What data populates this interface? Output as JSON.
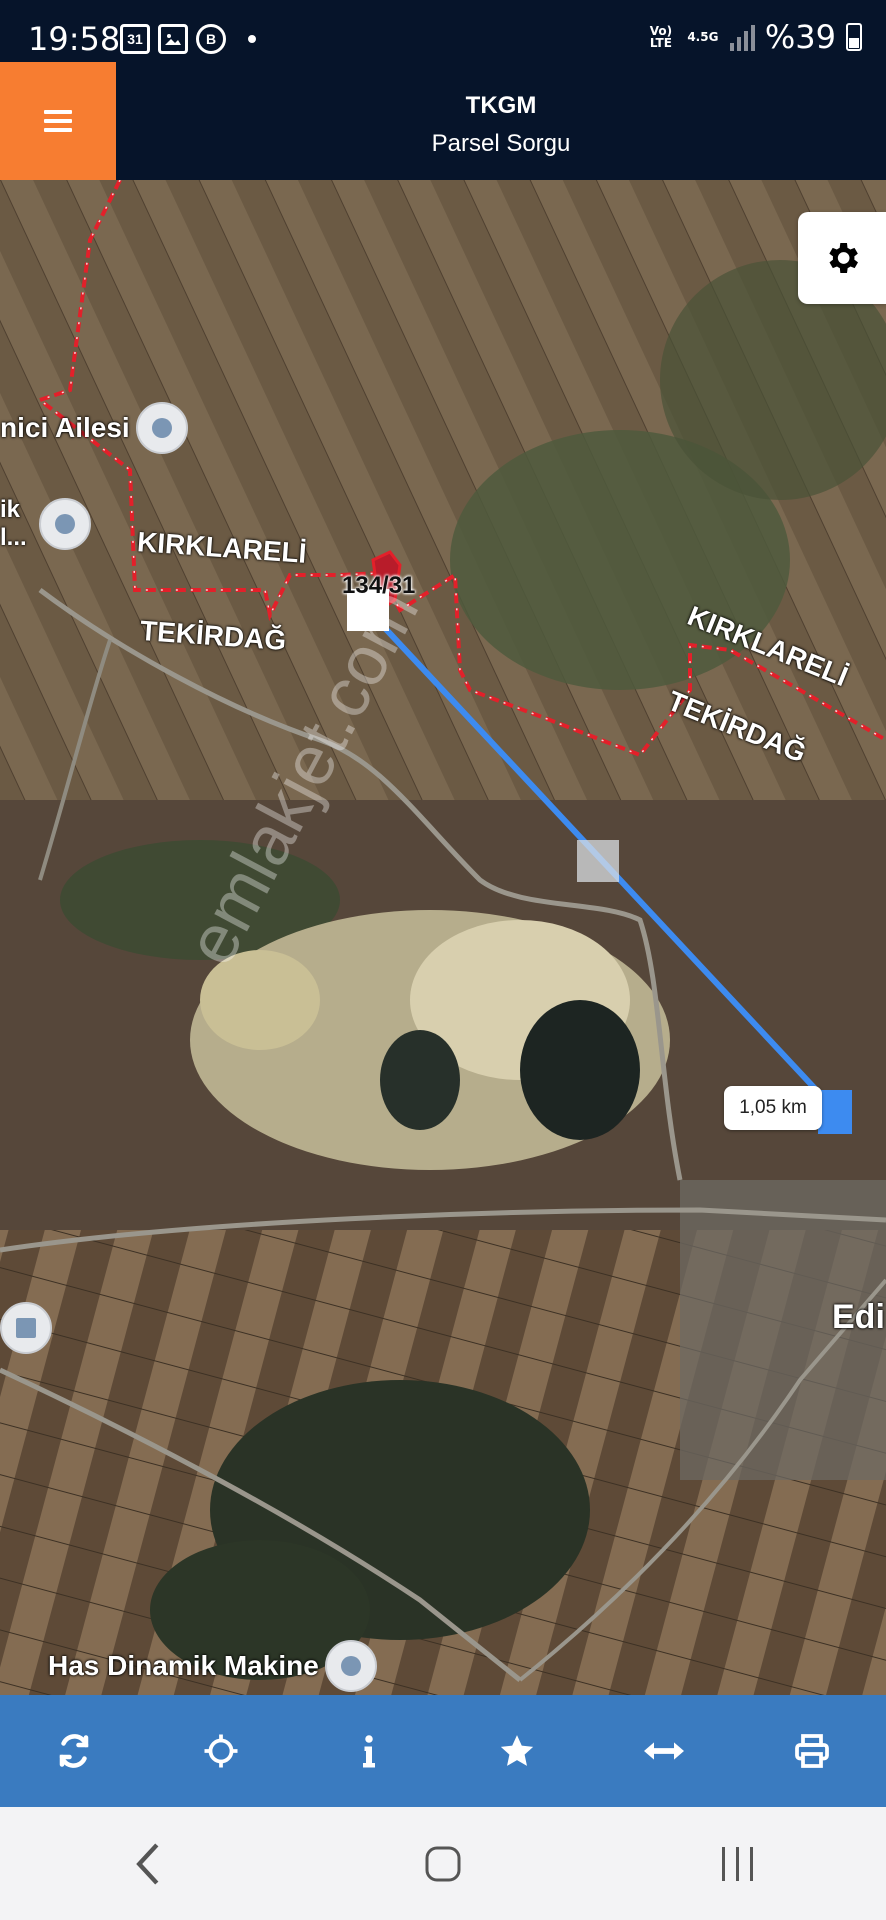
{
  "status_bar": {
    "time": "19:58",
    "left_icons": [
      "calendar-icon",
      "gallery-icon",
      "b-app-icon",
      "notification-dot-icon"
    ],
    "calendar_day": "31",
    "b_app_letter": "B",
    "network_top": "Vo) LTE",
    "network_type": "4.5G",
    "battery": "%39"
  },
  "header": {
    "menu_icon": "hamburger-menu-icon",
    "title": "TKGM",
    "subtitle": "Parsel Sorgu",
    "accent_color": "#f77d31",
    "background_color": "#06142a"
  },
  "map": {
    "settings_icon": "gear-icon",
    "labels": {
      "region_north_1": "KIRKLARELİ",
      "region_south_1": "TEKİRDAĞ",
      "region_north_2": "KIRKLARELİ",
      "region_south_2": "TEKİRDAĞ",
      "town": "Edi"
    },
    "pois": {
      "poi_1": "nici Ailesi",
      "poi_2_line1": "ik",
      "poi_2_line2": "l...",
      "poi_bottom": "Has Dinamik Makine"
    },
    "parcel_label": "134/31",
    "distance": "1,05 km",
    "watermark": "emlakjet.com",
    "boundary_color": "#e3202a",
    "measure_color": "#3d8bf0"
  },
  "toolbar": {
    "background_color": "#3a7bc0",
    "buttons": [
      "refresh-icon",
      "locate-icon",
      "info-icon",
      "star-icon",
      "measure-icon",
      "print-icon"
    ]
  },
  "nav_bar": {
    "buttons": [
      "back-icon",
      "home-icon",
      "recents-icon"
    ]
  }
}
